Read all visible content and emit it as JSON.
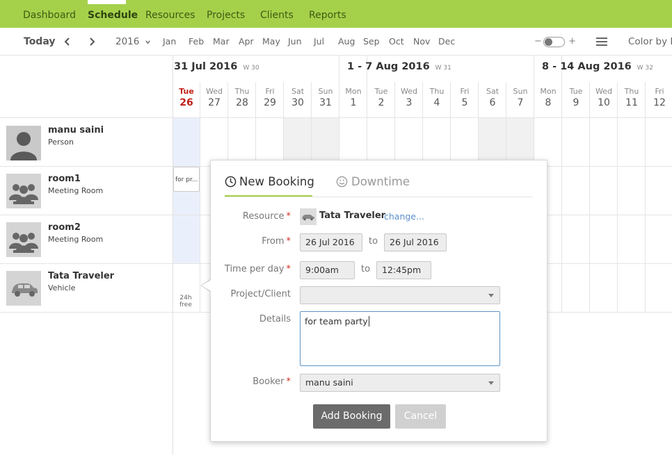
{
  "nav": {
    "items": [
      "Dashboard",
      "Schedule",
      "Resources",
      "Projects",
      "Clients",
      "Reports"
    ],
    "active": "Schedule"
  },
  "toolbar": {
    "today": "Today",
    "year": "2016",
    "months": [
      "Jan",
      "Feb",
      "Mar",
      "Apr",
      "May",
      "Jun",
      "Jul",
      "Aug",
      "Sep",
      "Oct",
      "Nov",
      "Dec"
    ],
    "zoom_minus": "−",
    "zoom_plus": "+",
    "color_by": "Color by P"
  },
  "calendar": {
    "weeks": [
      {
        "label": "31 Jul 2016",
        "week": "W 30"
      },
      {
        "label": "1 - 7 Aug 2016",
        "week": "W 31"
      },
      {
        "label": "8 - 14 Aug 2016",
        "week": "W 32"
      }
    ],
    "days": [
      {
        "name": "Tue",
        "date": "26"
      },
      {
        "name": "Wed",
        "date": "27"
      },
      {
        "name": "Thu",
        "date": "28"
      },
      {
        "name": "Fri",
        "date": "29"
      },
      {
        "name": "Sat",
        "date": "30"
      },
      {
        "name": "Sun",
        "date": "31"
      },
      {
        "name": "Mon",
        "date": "1"
      },
      {
        "name": "Tue",
        "date": "2"
      },
      {
        "name": "Wed",
        "date": "3"
      },
      {
        "name": "Thu",
        "date": "4"
      },
      {
        "name": "Fri",
        "date": "5"
      },
      {
        "name": "Sat",
        "date": "6"
      },
      {
        "name": "Sun",
        "date": "7"
      },
      {
        "name": "Mon",
        "date": "8"
      },
      {
        "name": "Tue",
        "date": "9"
      },
      {
        "name": "Wed",
        "date": "10"
      },
      {
        "name": "Thu",
        "date": "11"
      },
      {
        "name": "Fri",
        "date": "12"
      }
    ],
    "today_color": "#c0201a"
  },
  "resources": [
    {
      "name": "manu saini",
      "type": "Person",
      "icon": "person-icon"
    },
    {
      "name": "room1",
      "type": "Meeting Room",
      "icon": "group-icon"
    },
    {
      "name": "room2",
      "type": "Meeting Room",
      "icon": "group-icon"
    },
    {
      "name": "Tata Traveler",
      "type": "Vehicle",
      "icon": "car-icon"
    }
  ],
  "grid": {
    "booking_chip": "for pr...",
    "free_hours": "24h",
    "free_word": "free"
  },
  "popup": {
    "tab_new": "New Booking",
    "tab_downtime": "Downtime",
    "resource_label": "Resource",
    "resource_name": "Tata Traveler",
    "change_link": "change...",
    "from_label": "From",
    "from_date": "26 Jul 2016",
    "to_word": "to",
    "to_date": "26 Jul 2016",
    "time_label": "Time per day",
    "time_from": "9:00am",
    "time_to": "12:45pm",
    "project_label": "Project/Client",
    "project_value": "",
    "details_label": "Details",
    "details_value": "for team party",
    "booker_label": "Booker",
    "booker_value": "manu saini",
    "add_button": "Add Booking",
    "cancel_button": "Cancel",
    "accent": "#a5d14a"
  }
}
